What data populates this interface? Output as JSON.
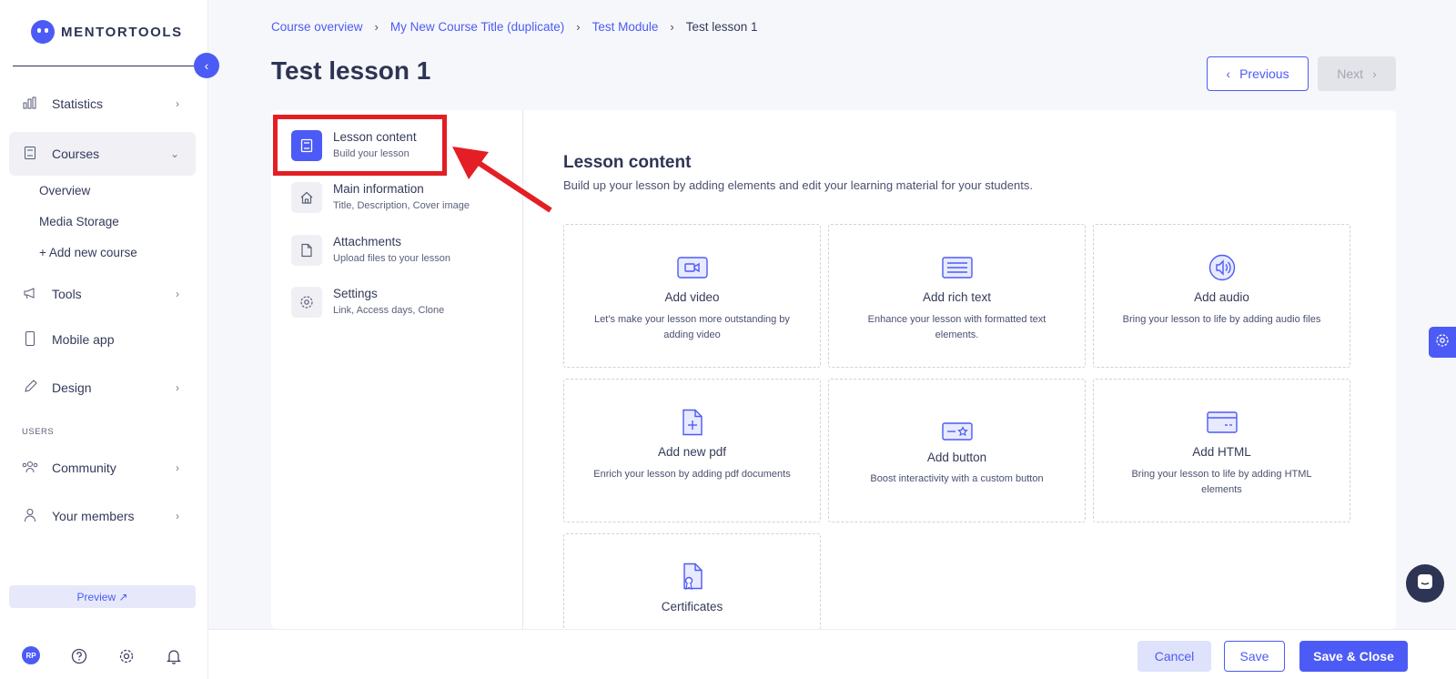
{
  "brand": {
    "name": "MENTORTOOLS"
  },
  "sidebar": {
    "collapse_icon": "chevron-left-icon",
    "items": [
      {
        "label": "Statistics",
        "icon": "bar-chart-icon"
      },
      {
        "label": "Courses",
        "icon": "book-icon"
      },
      {
        "label": "Tools",
        "icon": "megaphone-icon"
      },
      {
        "label": "Mobile app",
        "icon": "phone-icon"
      },
      {
        "label": "Design",
        "icon": "pencil-icon"
      },
      {
        "label": "Community",
        "icon": "people-icon"
      },
      {
        "label": "Your members",
        "icon": "user-icon"
      }
    ],
    "course_sub": [
      "Overview",
      "Media Storage",
      "+ Add new course"
    ],
    "section_users": "USERS",
    "preview": "Preview ↗",
    "avatar_initials": "RP"
  },
  "breadcrumb": [
    "Course overview",
    "My New Course Title (duplicate)",
    "Test Module",
    "Test lesson 1"
  ],
  "page_title": "Test lesson 1",
  "nav_buttons": {
    "previous": "Previous",
    "next": "Next"
  },
  "lesson_menu": [
    {
      "title": "Lesson content",
      "sub": "Build your lesson",
      "icon": "book-icon"
    },
    {
      "title": "Main information",
      "sub": "Title, Description, Cover image",
      "icon": "home-icon"
    },
    {
      "title": "Attachments",
      "sub": "Upload files to your lesson",
      "icon": "file-icon"
    },
    {
      "title": "Settings",
      "sub": "Link, Access days, Clone",
      "icon": "gear-icon"
    }
  ],
  "content": {
    "title": "Lesson content",
    "subtitle": "Build up your lesson by adding elements and edit your learning material for your students."
  },
  "cards": [
    {
      "title": "Add video",
      "desc": "Let's make your lesson more outstanding by adding video",
      "icon": "video-icon"
    },
    {
      "title": "Add rich text",
      "desc": "Enhance your lesson with formatted text elements.",
      "icon": "text-icon"
    },
    {
      "title": "Add audio",
      "desc": "Bring your lesson to life by adding audio files",
      "icon": "audio-icon"
    },
    {
      "title": "Add new pdf",
      "desc": "Enrich your lesson by adding pdf documents",
      "icon": "pdf-icon"
    },
    {
      "title": "Add button",
      "desc": "Boost interactivity with a custom button",
      "icon": "button-icon"
    },
    {
      "title": "Add HTML",
      "desc": "Bring your lesson to life by adding HTML elements",
      "icon": "html-icon"
    },
    {
      "title": "Certificates",
      "desc": "",
      "icon": "certificate-icon"
    }
  ],
  "footer": {
    "cancel": "Cancel",
    "save": "Save",
    "save_close": "Save & Close"
  },
  "colors": {
    "accent": "#4c5bf5",
    "annotation": "#e31e24"
  }
}
